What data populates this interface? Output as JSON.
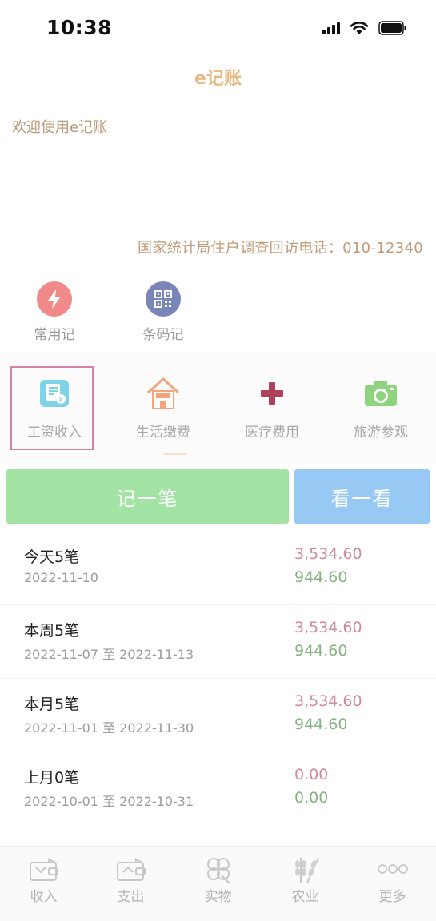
{
  "status": {
    "time": "10:38"
  },
  "app": {
    "title": "e记账",
    "welcome": "欢迎使用e记账",
    "hotline": "国家统计局住户调查回访电话：010-12340"
  },
  "quick_entries": [
    {
      "label": "常用记",
      "icon": "lightning-icon",
      "color": "#f08a8a"
    },
    {
      "label": "条码记",
      "icon": "qrcode-icon",
      "color": "#7b86b8"
    }
  ],
  "categories": [
    {
      "label": "工资收入",
      "icon": "salary-icon",
      "selected": true
    },
    {
      "label": "生活缴费",
      "icon": "house-icon"
    },
    {
      "label": "医疗费用",
      "icon": "medical-cross-icon"
    },
    {
      "label": "旅游参观",
      "icon": "camera-icon"
    }
  ],
  "actions": {
    "record_label": "记一笔",
    "view_label": "看一看"
  },
  "summary": [
    {
      "title": "今天5笔",
      "range": "2022-11-10",
      "expense": "3,534.60",
      "income": "944.60"
    },
    {
      "title": "本周5笔",
      "range": "2022-11-07 至 2022-11-13",
      "expense": "3,534.60",
      "income": "944.60"
    },
    {
      "title": "本月5笔",
      "range": "2022-11-01 至 2022-11-30",
      "expense": "3,534.60",
      "income": "944.60"
    },
    {
      "title": "上月0笔",
      "range": "2022-10-01 至 2022-10-31",
      "expense": "0.00",
      "income": "0.00"
    }
  ],
  "tabs": [
    {
      "label": "收入",
      "icon": "income-wallet-icon"
    },
    {
      "label": "支出",
      "icon": "expense-wallet-icon"
    },
    {
      "label": "实物",
      "icon": "clover-icon"
    },
    {
      "label": "农业",
      "icon": "wheat-icon"
    },
    {
      "label": "更多",
      "icon": "more-dots-icon"
    }
  ],
  "colors": {
    "accent": "#e6b984",
    "expense": "#d08a9c",
    "income": "#86b383",
    "record_button": "#a3e4a5",
    "view_button": "#98c9f5"
  }
}
